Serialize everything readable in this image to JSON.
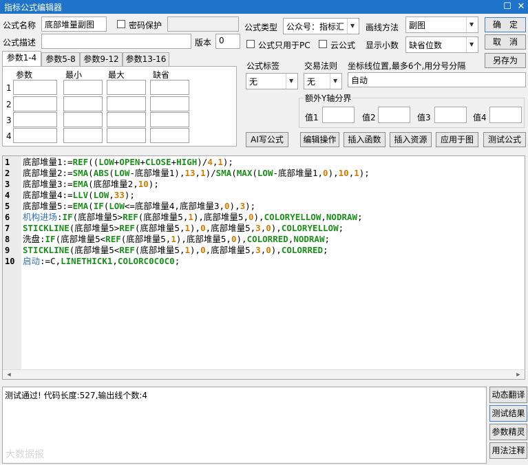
{
  "window": {
    "title": "指标公式编辑器",
    "restore_glyph": "☐",
    "close_glyph": "✕"
  },
  "top": {
    "name_label": "公式名称",
    "name_value": "底部堆量副图",
    "password_label": "密码保护",
    "desc_label": "公式描述",
    "desc_value": "",
    "version_label": "版本",
    "version_value": "0",
    "type_label": "公式类型",
    "type_value": "公众号：指标汇",
    "draw_label": "画线方法",
    "draw_value": "副图",
    "pc_only_label": "公式只用于PC",
    "cloud_label": "云公式",
    "decimals_label": "显示小数",
    "decimals_value": "缺省位数",
    "ok_label": "确　定",
    "cancel_label": "取　消",
    "saveas_label": "另存为"
  },
  "tabs": [
    "参数1-4",
    "参数5-8",
    "参数9-12",
    "参数13-16"
  ],
  "param_table": {
    "headers": [
      "参数",
      "最小",
      "最大",
      "缺省"
    ],
    "rows": [
      "1",
      "2",
      "3",
      "4"
    ]
  },
  "mid": {
    "tag_label": "公式标签",
    "tag_value": "无",
    "trade_label": "交易法则",
    "trade_value": "无",
    "coord_label": "坐标线位置,最多6个,用分号分隔",
    "coord_value": "自动",
    "yaxis_group": "额外Y轴分界",
    "yaxis_labels": [
      "值1",
      "值2",
      "值3",
      "值4"
    ]
  },
  "actions": [
    "AI写公式",
    "编辑操作",
    "插入函数",
    "插入资源",
    "应用于图",
    "测试公式"
  ],
  "code_lines": [
    "1",
    "2",
    "3",
    "4",
    "5",
    "6",
    "7",
    "8",
    "9",
    "10"
  ],
  "code_tokens": {
    "l1": [
      "底部堆量1:=",
      "REF",
      "((",
      "LOW",
      "+",
      "OPEN",
      "+",
      "CLOSE",
      "+",
      "HIGH",
      ")/",
      "4",
      ",",
      "1",
      ");"
    ],
    "l2": [
      "底部堆量2:=",
      "SMA",
      "(",
      "ABS",
      "(",
      "LOW",
      "-底部堆量1),",
      "13",
      ",",
      "1",
      ")/",
      "SMA",
      "(",
      "MAX",
      "(",
      "LOW",
      "-底部堆量1,",
      "0",
      "),",
      "10",
      ",",
      "1",
      ");"
    ],
    "l3": [
      "底部堆量3:=",
      "EMA",
      "(底部堆量2,",
      "10",
      ");"
    ],
    "l4": [
      "底部堆量4:=",
      "LLV",
      "(",
      "LOW",
      ",",
      "33",
      ");"
    ],
    "l5": [
      "底部堆量5:=",
      "EMA",
      "(",
      "IF",
      "(",
      "LOW",
      "<=底部堆量4,底部堆量3,",
      "0",
      "),",
      "3",
      ");"
    ],
    "l6": [
      "机构进场",
      ":",
      "IF",
      "(底部堆量5>",
      "REF",
      "(底部堆量5,",
      "1",
      "),底部堆量5,",
      "0",
      "),",
      "COLORYELLOW",
      ",",
      "NODRAW",
      ";"
    ],
    "l7": [
      "STICKLINE",
      "(底部堆量5>",
      "REF",
      "(底部堆量5,",
      "1",
      "),",
      "0",
      ",底部堆量5,",
      "3",
      ",",
      "0",
      "),",
      "COLORYELLOW",
      ";"
    ],
    "l8": [
      "洗盘:",
      "IF",
      "(底部堆量5<",
      "REF",
      "(底部堆量5,",
      "1",
      "),底部堆量5,",
      "0",
      "),",
      "COLORRED",
      ",",
      "NODRAW",
      ";"
    ],
    "l9": [
      "STICKLINE",
      "(底部堆量5<",
      "REF",
      "(底部堆量5,",
      "1",
      "),",
      "0",
      ",底部堆量5,",
      "3",
      ",",
      "0",
      "),",
      "COLORRED",
      ";"
    ],
    "l10": [
      "启动",
      ":=C,",
      "LINETHICK1",
      ",",
      "COLORC0C0C0",
      ";"
    ]
  },
  "result_text": "测试通过! 代码长度:527,输出线个数:4",
  "side_buttons": [
    "动态翻译",
    "测试结果",
    "参数精灵",
    "用法注释"
  ],
  "watermark": "大数据报"
}
